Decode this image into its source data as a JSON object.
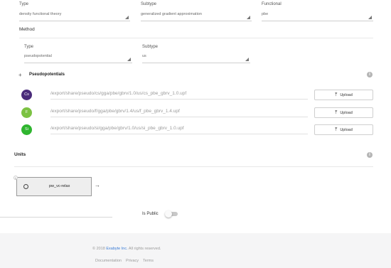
{
  "model": {
    "type_label": "Type",
    "type_value": "density functional theory",
    "subtype_label": "Subtype",
    "subtype_value": "generalized gradient approximation",
    "functional_label": "Functional",
    "functional_value": "pbe"
  },
  "method": {
    "title": "Method",
    "type_label": "Type",
    "type_value": "pseudopotential",
    "subtype_label": "Subtype",
    "subtype_value": "us"
  },
  "pseudopotentials": {
    "title": "Pseudopotentials",
    "upload_label": "Upload",
    "items": [
      {
        "symbol": "Cs",
        "path": "/export/share/pseudo/cs/gga/pbe/gbrv/1.0/us/cs_pbe_gbrv_1.0.upf",
        "color": "#4a2b7a"
      },
      {
        "symbol": "F",
        "path": "/export/share/pseudo/f/gga/pbe/gbrv/1.4/us/f_pbe_gbrv_1.4.upf",
        "color": "#7cc243"
      },
      {
        "symbol": "Si",
        "path": "/export/share/pseudo/si/gga/pbe/gbrv/1.0/us/si_pbe_gbrv_1.0.upf",
        "color": "#2fb52f"
      }
    ]
  },
  "units": {
    "title": "Units",
    "workflow_unit_label": "pw_vc-relax",
    "index": "0"
  },
  "is_public_label": "Is Public",
  "is_public": false,
  "footer": {
    "copyright_prefix": "© 2018",
    "company": "Exabyte Inc.",
    "copyright_suffix": "All rights reserved.",
    "links": [
      "Documentation",
      "Privacy",
      "Terms"
    ]
  },
  "colors": {
    "link": "#3a7bd5",
    "footer_bg": "#f5f5f6"
  }
}
